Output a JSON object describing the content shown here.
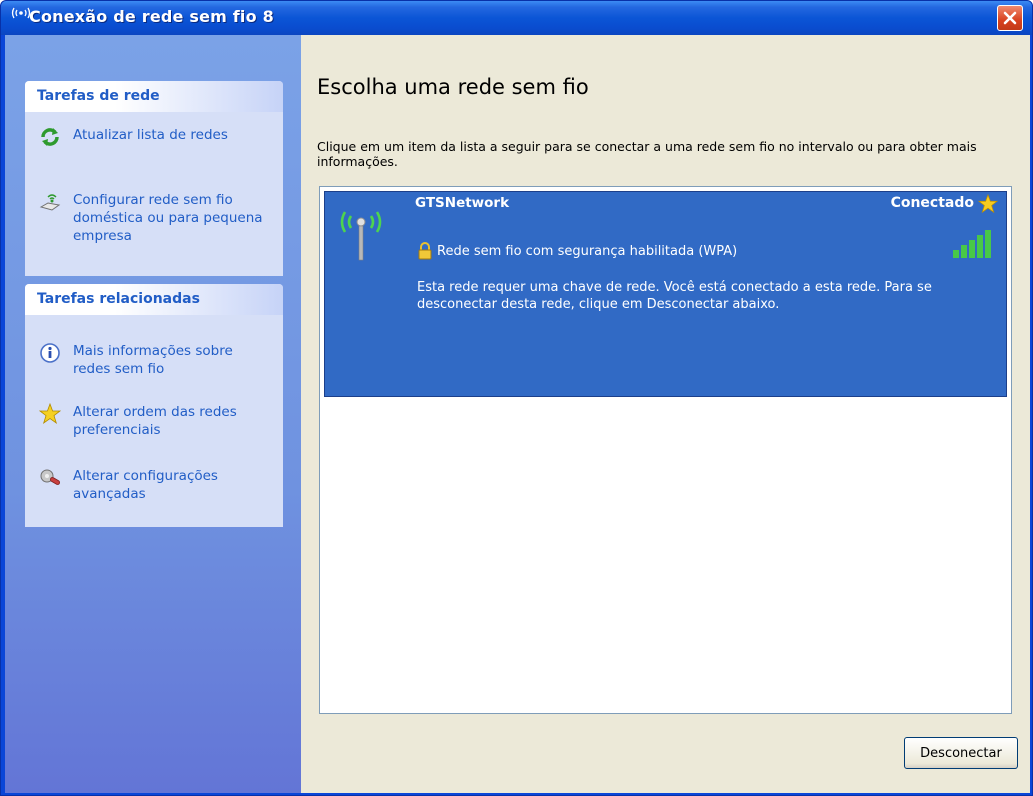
{
  "window": {
    "title": "Conexão de rede sem fio 8"
  },
  "colors": {
    "titlebar": "#0b55d6",
    "sidebar": "#7ba2e7",
    "selection": "#316ac5",
    "link": "#215dc6",
    "close": "#d8421f"
  },
  "icons": {
    "title": "wireless-antenna-icon",
    "close": "close-icon"
  },
  "sidebar": {
    "network_tasks": {
      "header": "Tarefas de rede",
      "items": [
        {
          "label": "Atualizar lista de redes",
          "icon": "refresh-icon"
        },
        {
          "label": "Configurar rede sem fio doméstica ou para pequena empresa",
          "icon": "wireless-setup-icon"
        }
      ]
    },
    "related_tasks": {
      "header": "Tarefas relacionadas",
      "items": [
        {
          "label": "Mais informações sobre redes sem fio",
          "icon": "info-icon"
        },
        {
          "label": "Alterar ordem das redes preferenciais",
          "icon": "star-icon"
        },
        {
          "label": "Alterar configurações avançadas",
          "icon": "settings-icon"
        }
      ]
    }
  },
  "main": {
    "heading": "Escolha uma rede sem fio",
    "instructions": "Clique em um item da lista a seguir para se conectar a uma rede sem fio no intervalo ou para obter mais informações.",
    "networks": [
      {
        "name": "GTSNetwork",
        "status": "Conectado",
        "security": "Rede sem fio com segurança habilitada (WPA)",
        "description": "Esta rede requer uma chave de rede. Você está conectado a esta rede. Para se desconectar desta rede, clique em Desconectar abaixo.",
        "signal_bars": 5,
        "signal_max": 5,
        "selected": true
      }
    ],
    "disconnect_button": "Desconectar"
  }
}
